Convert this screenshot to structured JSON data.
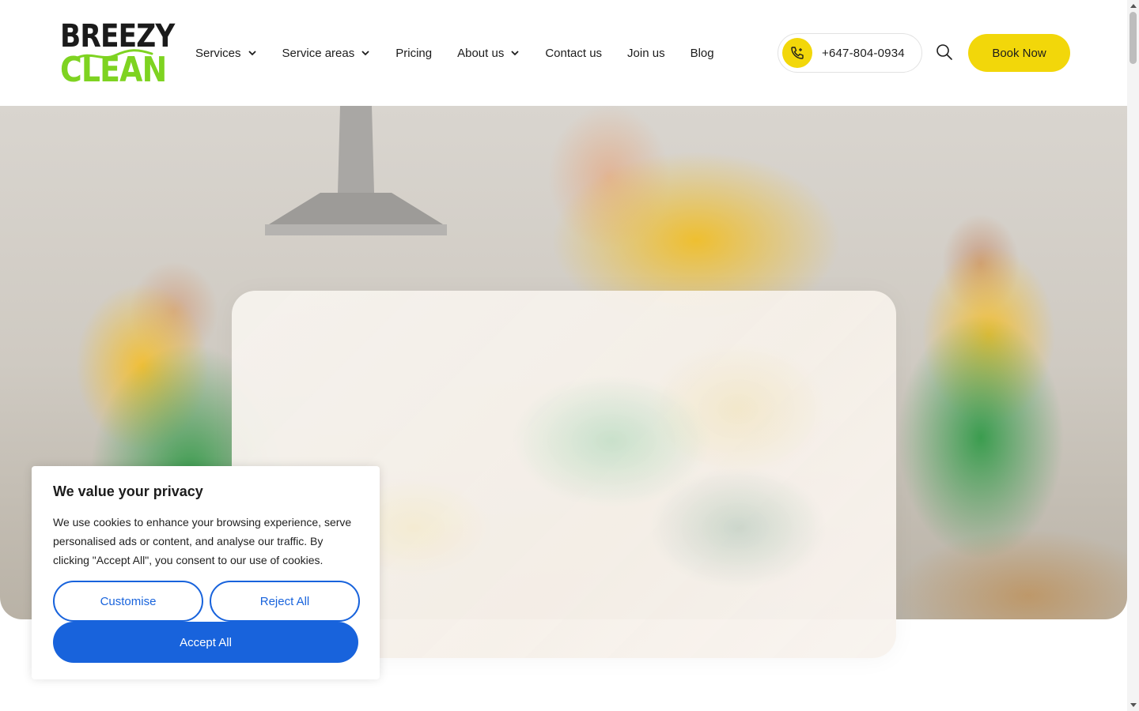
{
  "logo": {
    "line1": "BREEZY",
    "line2": "CLEAN",
    "alt": "Breezy Clean logo"
  },
  "nav": {
    "items": [
      {
        "label": "Services",
        "has_dropdown": true
      },
      {
        "label": "Service areas",
        "has_dropdown": true
      },
      {
        "label": "Pricing",
        "has_dropdown": false
      },
      {
        "label": "About us",
        "has_dropdown": true
      },
      {
        "label": "Contact us",
        "has_dropdown": false
      },
      {
        "label": "Join us",
        "has_dropdown": false
      },
      {
        "label": "Blog",
        "has_dropdown": false
      }
    ]
  },
  "header": {
    "phone": "+647-804-0934",
    "phone_icon": "phone-icon",
    "search_icon": "search-icon",
    "book_label": "Book Now"
  },
  "hero": {
    "image_description_icon": "hero-photo-cleaners"
  },
  "cookie_banner": {
    "title": "We value your privacy",
    "text": "We use cookies to enhance your browsing experience, serve personalised ads or content, and analyse our traffic. By clicking \"Accept All\", you consent to our use of cookies.",
    "customise_label": "Customise",
    "reject_label": "Reject All",
    "accept_label": "Accept All"
  },
  "colors": {
    "brand_yellow": "#f2d70a",
    "brand_green": "#7ed321",
    "consent_blue": "#1863dc",
    "text_dark": "#1c1c1c"
  }
}
